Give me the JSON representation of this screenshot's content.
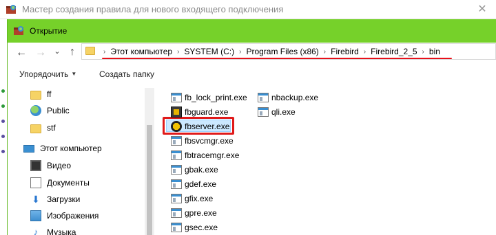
{
  "outer_window": {
    "title": "Мастер создания правила для нового входящего подключения",
    "close_glyph": "✕"
  },
  "dialog": {
    "title": "Открытие",
    "title_bar_color": "#76d12a"
  },
  "nav_buttons": {
    "back": "←",
    "forward": "→",
    "recent": "⌄",
    "up": "↑"
  },
  "address_bar": {
    "crumbs": [
      "Этот компьютер",
      "SYSTEM (C:)",
      "Program Files (x86)",
      "Firebird",
      "Firebird_2_5",
      "bin"
    ],
    "separator": "›"
  },
  "toolbar": {
    "organize_label": "Упорядочить",
    "organize_caret": "▼",
    "new_folder_label": "Создать папку"
  },
  "nav_pane": {
    "items": [
      {
        "label": "ff",
        "icon": "folder-icon"
      },
      {
        "label": "Public",
        "icon": "globe-icon"
      },
      {
        "label": "stf",
        "icon": "folder-icon"
      },
      {
        "label": "Этот компьютер",
        "icon": "computer-icon"
      },
      {
        "label": "Видео",
        "icon": "video-icon"
      },
      {
        "label": "Документы",
        "icon": "documents-icon"
      },
      {
        "label": "Загрузки",
        "icon": "downloads-icon"
      },
      {
        "label": "Изображения",
        "icon": "pictures-icon"
      },
      {
        "label": "Музыка",
        "icon": "music-icon"
      }
    ],
    "download_glyph": "⬇",
    "music_glyph": "♪"
  },
  "files": {
    "column1": [
      "fb_lock_print.exe",
      "fbguard.exe",
      "fbserver.exe",
      "fbsvcmgr.exe",
      "fbtracemgr.exe",
      "gbak.exe",
      "gdef.exe",
      "gfix.exe",
      "gpre.exe",
      "gsec.exe"
    ],
    "column2": [
      "nbackup.exe",
      "qli.exe"
    ],
    "selected": "fbserver.exe"
  },
  "highlight_color": "#e01a1a"
}
